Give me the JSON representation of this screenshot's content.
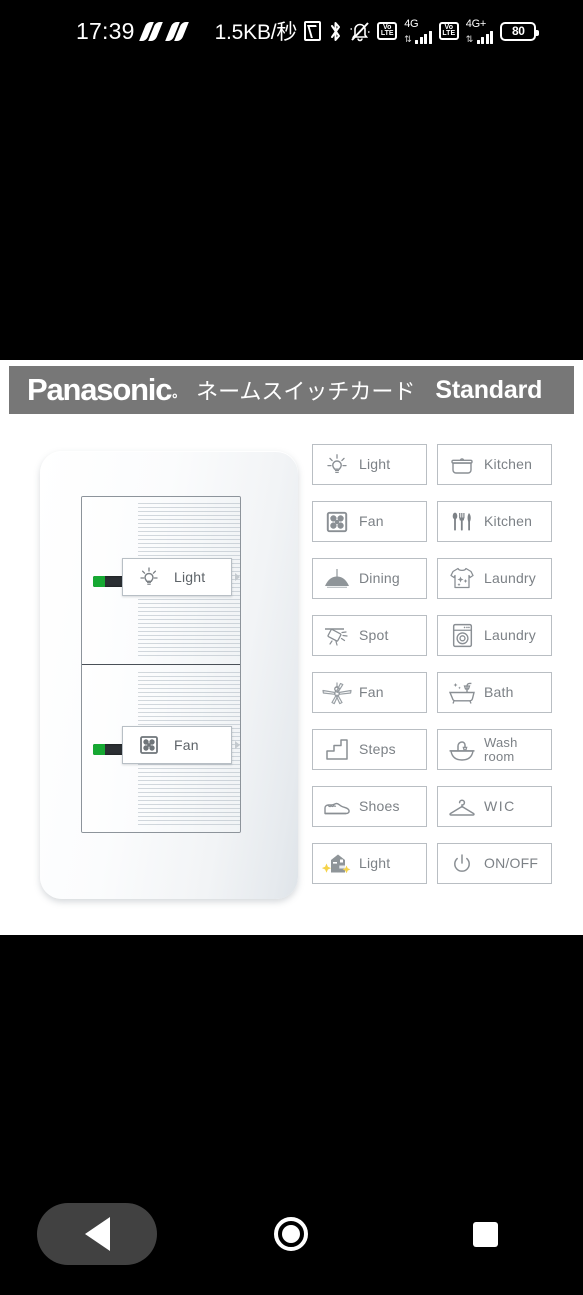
{
  "statusbar": {
    "time": "17:39",
    "icons_left": [
      "swirl-icon",
      "swirl-icon"
    ],
    "data_rate": "1.5KB/秒",
    "nfc": "nfc-icon",
    "bluetooth": "bluetooth-icon",
    "silent": "mute-bell-icon",
    "volte_label_top": "Vo",
    "volte_label_bottom": "LTE",
    "sim1_network": "4G",
    "sim2_network": "4G+",
    "battery_percent": "80"
  },
  "header": {
    "brand": "Panasonic",
    "brand_mark": "。",
    "product_jp": "ネームスイッチカード",
    "variant": "Standard",
    "bar_color": "#777777"
  },
  "photo": {
    "name": "panasonic-wall-switch-plate",
    "switches": [
      {
        "label": "Light",
        "icon": "bulb-icon",
        "led": "on",
        "led_color": "#16a832"
      },
      {
        "label": "Fan",
        "icon": "vent-fan-icon",
        "led": "on",
        "led_color": "#16a832"
      }
    ]
  },
  "cards": [
    {
      "label": "Light",
      "icon": "bulb-icon",
      "lines": 1
    },
    {
      "label": "Kitchen",
      "icon": "pot-icon",
      "lines": 1
    },
    {
      "label": "Fan",
      "icon": "vent-fan-icon",
      "lines": 1
    },
    {
      "label": "Kitchen",
      "icon": "cutlery-icon",
      "lines": 1
    },
    {
      "label": "Dining",
      "icon": "pendant-lamp-icon",
      "lines": 1
    },
    {
      "label": "Laundry",
      "icon": "tshirt-icon",
      "lines": 1
    },
    {
      "label": "Spot",
      "icon": "spotlight-icon",
      "lines": 1
    },
    {
      "label": "Laundry",
      "icon": "washer-icon",
      "lines": 1
    },
    {
      "label": "Fan",
      "icon": "ceiling-fan-icon",
      "lines": 1
    },
    {
      "label": "Bath",
      "icon": "bathtub-icon",
      "lines": 1
    },
    {
      "label": "Steps",
      "icon": "stairs-icon",
      "lines": 1
    },
    {
      "label": "Wash\nroom",
      "icon": "washbasin-icon",
      "lines": 2
    },
    {
      "label": "Shoes",
      "icon": "shoe-icon",
      "lines": 1
    },
    {
      "label": "WIC",
      "icon": "hanger-icon",
      "lines": 1
    },
    {
      "label": "Light",
      "icon": "porch-light-icon",
      "lines": 1,
      "accent": "#f5d34a"
    },
    {
      "label": "ON/OFF",
      "icon": "power-icon",
      "lines": 1
    }
  ],
  "navbar": {
    "back_label": "Back",
    "home_label": "Home",
    "recents_label": "Recents",
    "back_pressed": true
  }
}
